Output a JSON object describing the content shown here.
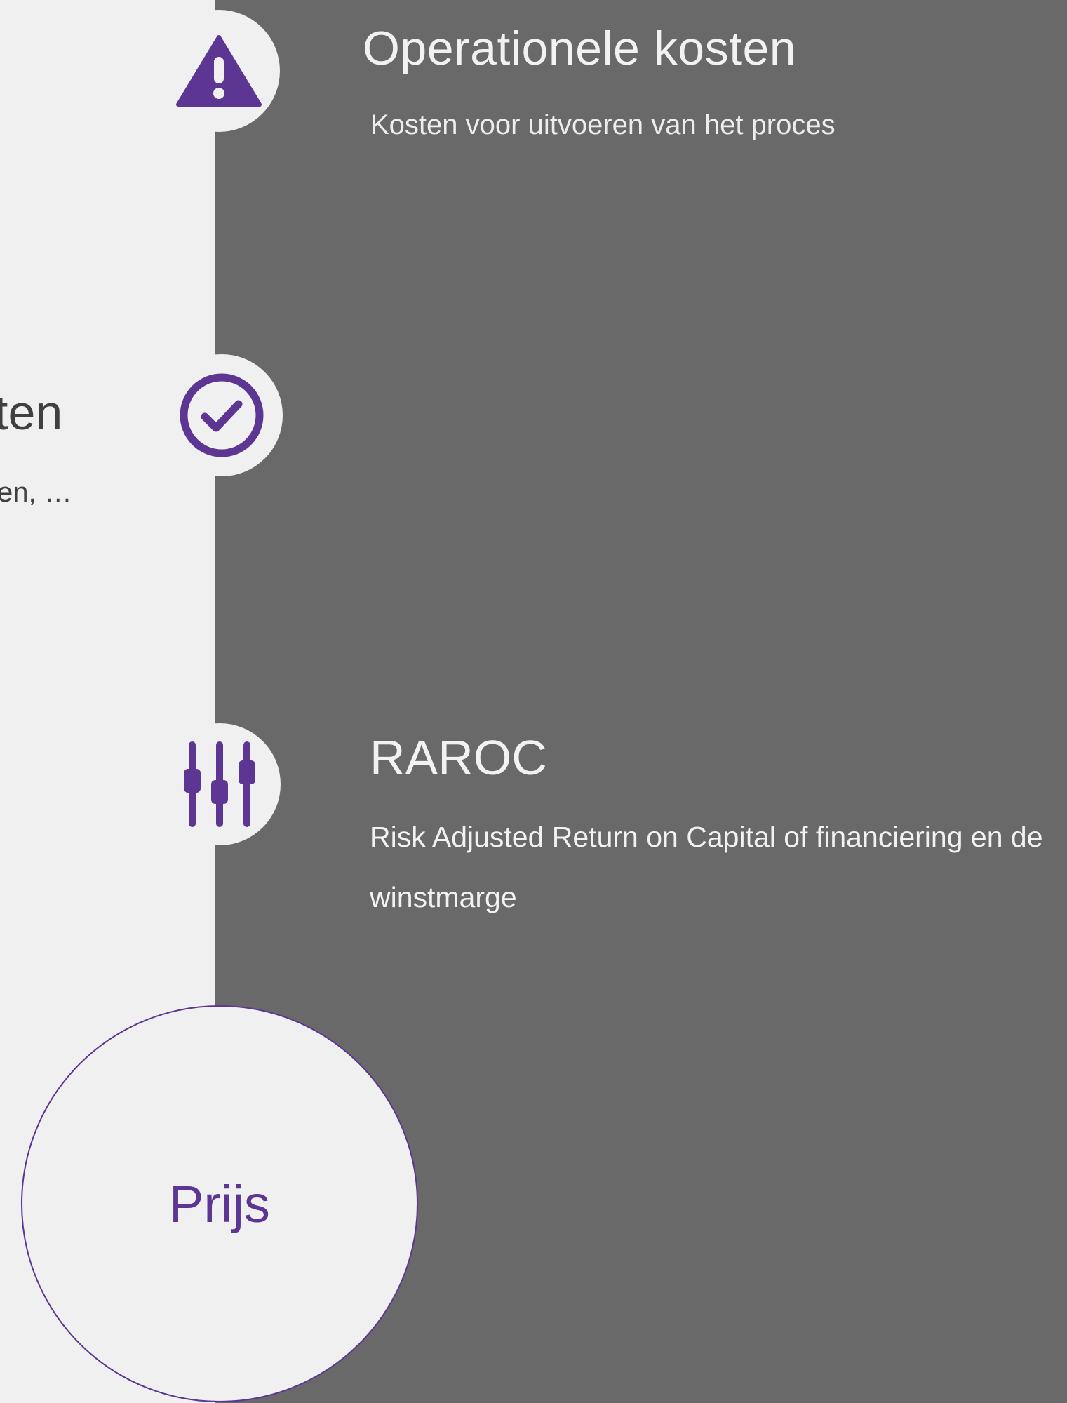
{
  "colors": {
    "accent": "#5c3692",
    "dark_panel": "#696969",
    "light_panel": "#f0f0f0",
    "light_text": "#f2f2f2",
    "dark_text": "#404040"
  },
  "timeline": {
    "items": [
      {
        "icon": "warning-icon",
        "title": "Operationele kosten",
        "description": "Kosten voor uitvoeren van het proces"
      },
      {
        "icon": "check-circle-icon",
        "title_fragment": "ten",
        "description_fragment": "en, …"
      },
      {
        "icon": "sliders-icon",
        "title": "RAROC",
        "description": "Risk Adjusted Return on Capital of financiering en de winstmarge"
      }
    ]
  },
  "price": {
    "label": "Prijs"
  }
}
